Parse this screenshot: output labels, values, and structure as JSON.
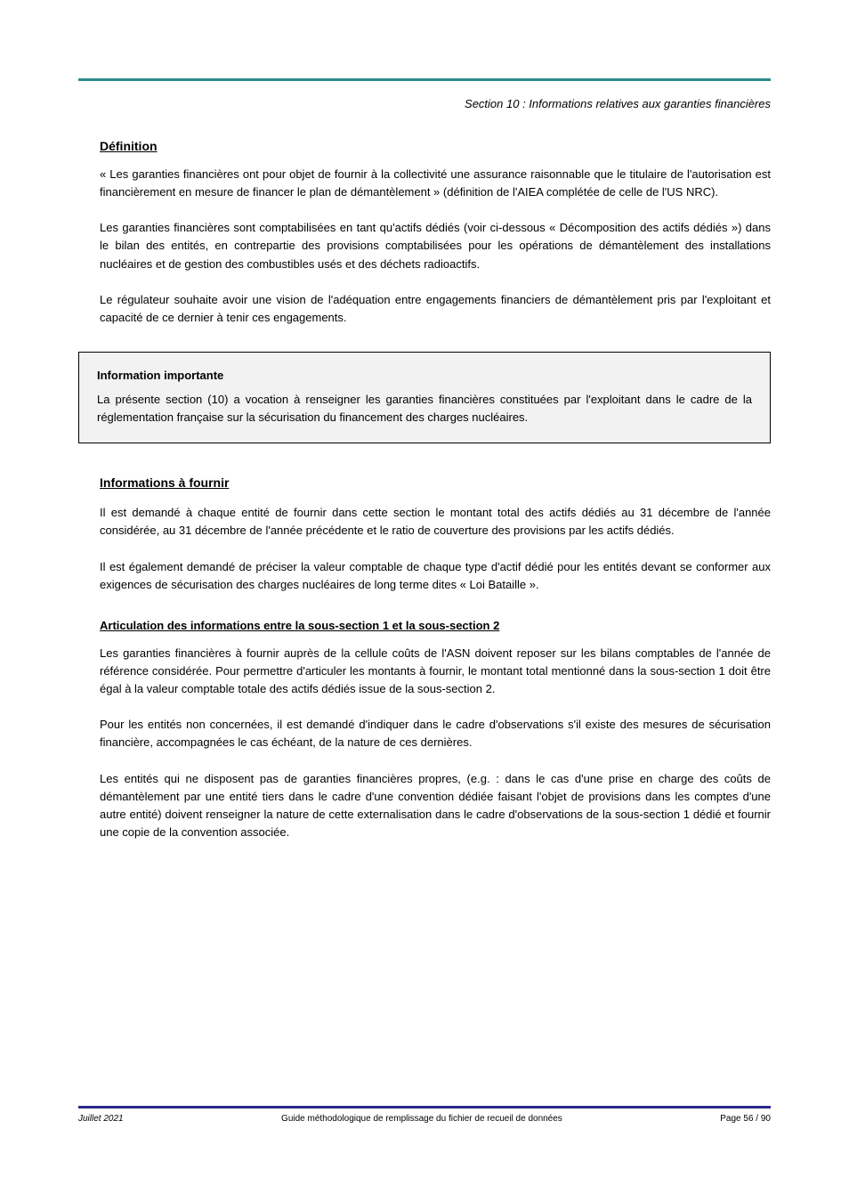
{
  "header": {
    "section_title": "Section 10 : Informations relatives aux garanties financières"
  },
  "s1": {
    "heading": "Définition",
    "p1": "« Les garanties financières ont pour objet de fournir à la collectivité une assurance raisonnable que le titulaire de l'autorisation est financièrement en mesure de financer le plan de démantèlement » (définition de l'AIEA complétée de celle de l'US NRC).",
    "p2": "Les garanties financières sont comptabilisées en tant qu'actifs dédiés (voir ci-dessous « Décomposition des actifs dédiés ») dans le bilan des entités, en contrepartie des provisions comptabilisées pour les opérations de démantèlement des installations nucléaires et de gestion des combustibles usés et des déchets radioactifs.",
    "p3": "Le régulateur souhaite avoir une vision de l'adéquation entre engagements financiers de démantèlement pris par l'exploitant et capacité de ce dernier à tenir ces engagements."
  },
  "box": {
    "heading": "Information importante",
    "body": "La présente section (10) a vocation à renseigner les garanties financières constituées par l'exploitant dans le cadre de la réglementation française sur la sécurisation du financement des charges nucléaires."
  },
  "s2": {
    "heading": "Informations à fournir",
    "p1": "Il est demandé à chaque entité de fournir dans cette section le montant total des actifs dédiés au 31 décembre de l'année considérée, au 31 décembre de l'année précédente et le ratio de couverture des provisions par les actifs dédiés.",
    "p2": "Il est également demandé de préciser la valeur comptable de chaque type d'actif dédié pour les entités devant se conformer aux exigences de sécurisation des charges nucléaires de long terme dites « Loi Bataille »."
  },
  "s3": {
    "heading": "Articulation des informations entre la sous-section 1 et la sous-section 2",
    "p1": "Les garanties financières à fournir auprès de la cellule coûts de l'ASN doivent reposer sur les bilans comptables de l'année de référence considérée. Pour permettre d'articuler les montants à fournir, le montant total mentionné dans la sous-section 1 doit être égal à la valeur comptable totale des actifs dédiés issue de la sous-section 2.",
    "p2": "Pour les entités non concernées, il est demandé d'indiquer dans le cadre d'observations s'il existe des mesures de sécurisation financière, accompagnées le cas échéant, de la nature de ces dernières.",
    "p3": "Les entités qui ne disposent pas de garanties financières propres, (e.g. : dans le cas d'une prise en charge des coûts de démantèlement par une entité tiers dans le cadre d'une convention dédiée faisant l'objet de provisions dans les comptes d'une autre entité) doivent renseigner la nature de cette externalisation dans le cadre d'observations de la sous-section 1 dédié et fournir une copie de la convention associée."
  },
  "footer": {
    "left": "Juillet 2021",
    "center": "Guide méthodologique de remplissage du fichier de recueil de données",
    "right": "Page 56 / 90"
  }
}
